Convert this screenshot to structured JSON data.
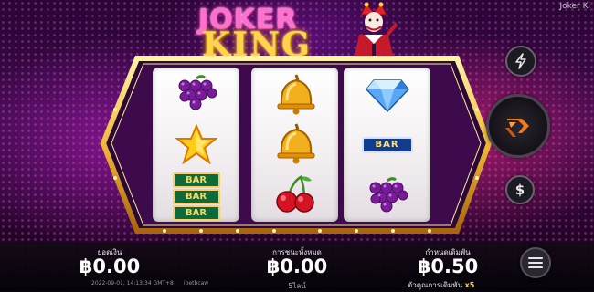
{
  "window": {
    "corner_title": "Joker Ki"
  },
  "logo": {
    "line1": "JOKER",
    "line2": "KING"
  },
  "reels": [
    {
      "symbols": [
        "grapes-icon",
        "star-icon",
        "triple-bar-icon"
      ]
    },
    {
      "symbols": [
        "bell-icon",
        "bell-icon",
        "cherries-icon"
      ]
    },
    {
      "symbols": [
        "diamond-icon",
        "bar-icon",
        "grapes-icon"
      ]
    }
  ],
  "bar_texts": {
    "bar": "BAR"
  },
  "side_buttons": [
    "turbo-lightning-button",
    "spin-button",
    "bet-dollar-button"
  ],
  "balance": {
    "label": "ยอดเงิน",
    "value": "฿0.00"
  },
  "total_win": {
    "label": "การชนะทั้งหมด",
    "value": "฿0.00",
    "lines": "5ไลน์"
  },
  "bet": {
    "label": "กำหนดเดิมพัน",
    "value": "฿0.50",
    "multiplier_label": "ตัวคูณการเดิมพัน",
    "multiplier_value": "x5"
  },
  "footer_info": {
    "datetime": "2022-09-01, 14:13:34 GMT+8",
    "user": "ibetbcaw"
  },
  "colors": {
    "accent_gold": "#f5cf4a",
    "frame_gold": "#f0b93a",
    "panel": "#0c0810"
  }
}
